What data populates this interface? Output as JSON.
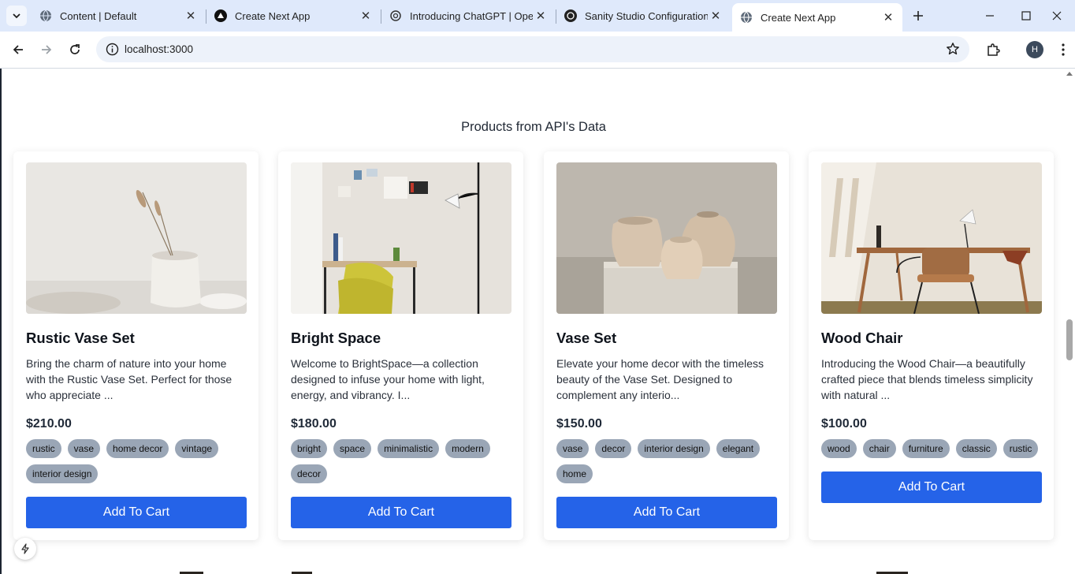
{
  "browser": {
    "tabs": [
      {
        "title": "Content | Default",
        "favicon": "globe-icon"
      },
      {
        "title": "Create Next App",
        "favicon": "vercel-triangle-icon"
      },
      {
        "title": "Introducing ChatGPT | Open",
        "favicon": "openai-icon"
      },
      {
        "title": "Sanity Studio Configuration",
        "favicon": "openai-icon"
      },
      {
        "title": "Create Next App",
        "favicon": "globe-icon",
        "active": true
      }
    ],
    "url": "localhost:3000",
    "profile_initial": "H"
  },
  "page": {
    "section_title": "Products from API's Data",
    "accent_color": "#2563e8",
    "products": [
      {
        "name": "Rustic Vase Set",
        "description": "Bring the charm of nature into your home with the Rustic Vase Set. Perfect for those who appreciate ...",
        "price": "$210.00",
        "tags": [
          "rustic",
          "vase",
          "home decor",
          "vintage",
          "interior design"
        ],
        "button_label": "Add To Cart"
      },
      {
        "name": "Bright Space",
        "description": "Welcome to BrightSpace—a collection designed to infuse your home with light, energy, and vibrancy. I...",
        "price": "$180.00",
        "tags": [
          "bright",
          "space",
          "minimalistic",
          "modern",
          "decor"
        ],
        "button_label": "Add To Cart"
      },
      {
        "name": "Vase Set",
        "description": "Elevate your home decor with the timeless beauty of the Vase Set. Designed to complement any interio...",
        "price": "$150.00",
        "tags": [
          "vase",
          "decor",
          "interior design",
          "elegant",
          "home"
        ],
        "button_label": "Add To Cart"
      },
      {
        "name": "Wood Chair",
        "description": "Introducing the Wood Chair—a beautifully crafted piece that blends timeless simplicity with natural ...",
        "price": "$100.00",
        "tags": [
          "wood",
          "chair",
          "furniture",
          "classic",
          "rustic"
        ],
        "button_label": "Add To Cart"
      }
    ]
  }
}
